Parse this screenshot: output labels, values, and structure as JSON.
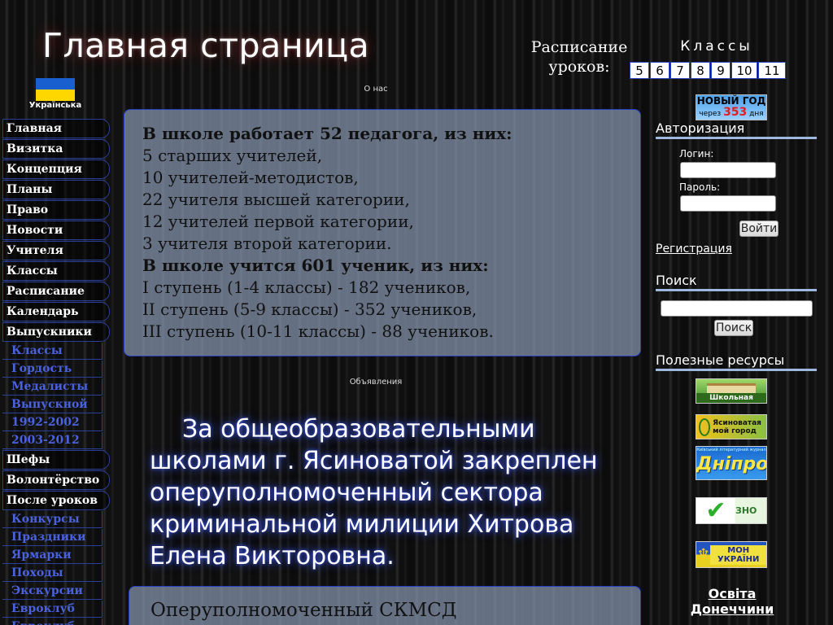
{
  "header": {
    "title": "Главная страница",
    "language_label": "Українська",
    "schedule_label": "Расписание уроков:",
    "classes_label": "Классы",
    "class_numbers": [
      "5",
      "6",
      "7",
      "8",
      "9",
      "10",
      "11"
    ]
  },
  "sections": {
    "about": "О нас",
    "announcements": "Объявления"
  },
  "menu": [
    {
      "label": "Главная",
      "sub": false
    },
    {
      "label": "Визитка",
      "sub": false
    },
    {
      "label": "Концепция",
      "sub": false
    },
    {
      "label": "Планы",
      "sub": false
    },
    {
      "label": "Право",
      "sub": false
    },
    {
      "label": "Новости",
      "sub": false
    },
    {
      "label": "Учителя",
      "sub": false
    },
    {
      "label": "Классы",
      "sub": false
    },
    {
      "label": "Расписание",
      "sub": false
    },
    {
      "label": "Календарь",
      "sub": false
    },
    {
      "label": "Выпускники",
      "sub": false
    },
    {
      "label": "Классы",
      "sub": true
    },
    {
      "label": "Гордость",
      "sub": true
    },
    {
      "label": "Медалисты",
      "sub": true
    },
    {
      "label": "Выпускной",
      "sub": true
    },
    {
      "label": "1992-2002",
      "sub": true
    },
    {
      "label": "2003-2012",
      "sub": true
    },
    {
      "label": "Шефы",
      "sub": false
    },
    {
      "label": "Волонтёрство",
      "sub": false
    },
    {
      "label": "После уроков",
      "sub": false
    },
    {
      "label": "Конкурсы",
      "sub": true
    },
    {
      "label": "Праздники",
      "sub": true
    },
    {
      "label": "Ярмарки",
      "sub": true
    },
    {
      "label": "Походы",
      "sub": true
    },
    {
      "label": "Экскурсии",
      "sub": true
    },
    {
      "label": "Евроклуб",
      "sub": true
    },
    {
      "label": "Евроклуб",
      "sub": true
    }
  ],
  "info": {
    "teachers_heading": "В школе работает 52 педагога, из них:",
    "teachers": [
      "5 старших учителей,",
      "10 учителей-методистов,",
      "22 учителя высшей категории,",
      "12 учителей первой категории,",
      "3 учителя второй категории."
    ],
    "students_heading": "В школе учится 601 ученик, из них:",
    "students": [
      "I ступень (1-4 классы) - 182 учеников,",
      "II ступень (5-9 классы) - 352 учеников,",
      "III ступень (10-11 классы) - 88 учеников."
    ]
  },
  "announcement": {
    "text": "За общеобразовательными школами г. Ясиноватой закреплен оперуполномоченный сектора криминальной милиции Хитрова Елена Викторовна.",
    "second_box": "Оперуполномоченный СКМСД"
  },
  "new_year": {
    "title": "НОВЫЙ ГОД",
    "prefix": "через",
    "days": "353",
    "suffix": "дня"
  },
  "auth": {
    "heading": "Авторизация",
    "login_label": "Логин:",
    "password_label": "Пароль:",
    "login_button": "Войти",
    "register_link": "Регистрация"
  },
  "search": {
    "heading": "Поиск",
    "button": "Поиск"
  },
  "resources": {
    "heading": "Полезные ресурсы",
    "banners": [
      "Школьная газета",
      "Ясиноватая мой город",
      "Дніпро",
      "ЗНО",
      "МОН УКРАЇНИ"
    ],
    "dnipro_caption": "Київський літературний журнал",
    "osvita": "Освіта Донеччини"
  },
  "colors": {
    "accent_blue": "#2740c8",
    "submenu_text": "#4a62e0",
    "box_fill": "#8796af"
  }
}
